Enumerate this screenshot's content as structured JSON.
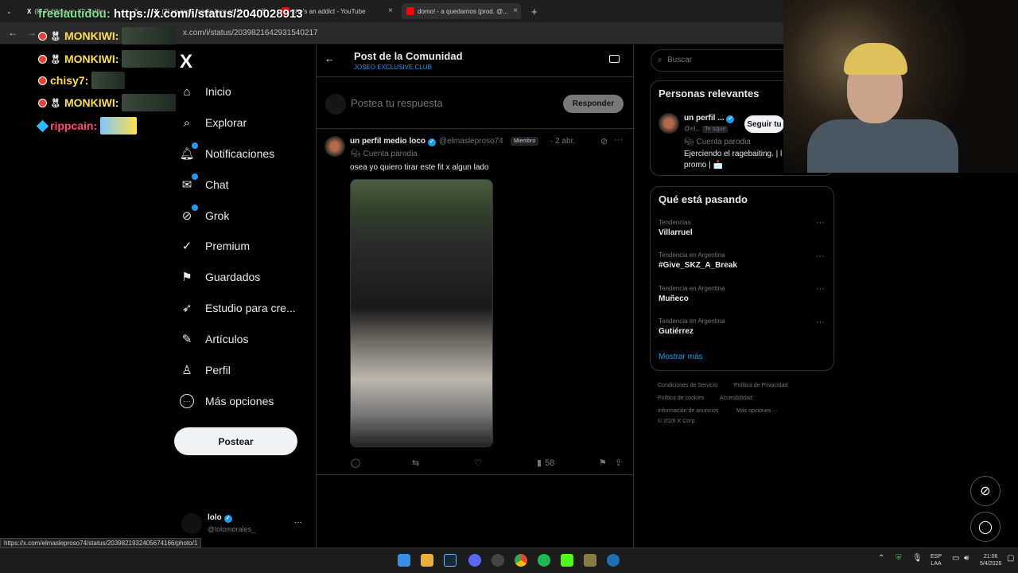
{
  "browser": {
    "tabs": [
      {
        "label": "(8) Publicar en X / Twitter",
        "favicon": "x-favicon"
      },
      {
        "label": "(3) un perfil medio loco en X",
        "favicon": "x-favicon"
      },
      {
        "label": "she's an addict - YouTube",
        "favicon": "youtube-favicon"
      },
      {
        "label": "domo! - a quedarnos (prod. @...",
        "favicon": "youtube-favicon"
      }
    ],
    "new_tab": "+",
    "url": "x.com/i/status/2039821642931540217"
  },
  "overlay": {
    "title_name": "freelautidou:",
    "title_link": " https://x.com/i/status/2040028913",
    "chat": [
      {
        "user": "MONKIWI:",
        "color": "#ffde59"
      },
      {
        "user": "MONKIWI:",
        "color": "#ffde59"
      },
      {
        "user": "chisy7:",
        "color": "#ffde59"
      },
      {
        "user": "MONKIWI:",
        "color": "#ffde59"
      },
      {
        "user": "rippcain:",
        "color": "#ff4d6d"
      }
    ]
  },
  "sidebar": {
    "logo": "X",
    "items": [
      {
        "label": "Inicio",
        "icon": "home-icon",
        "glyph": "⌂"
      },
      {
        "label": "Explorar",
        "icon": "search-icon",
        "glyph": "⌕"
      },
      {
        "label": "Notificaciones",
        "icon": "bell-icon",
        "glyph": "🔔︎",
        "badge": true
      },
      {
        "label": "Chat",
        "icon": "chat-icon",
        "glyph": "✉",
        "badge": true
      },
      {
        "label": "Grok",
        "icon": "grok-icon",
        "glyph": "⊘",
        "badge": true
      },
      {
        "label": "Premium",
        "icon": "premium-icon",
        "glyph": "✓"
      },
      {
        "label": "Guardados",
        "icon": "bookmark-icon",
        "glyph": "⚑"
      },
      {
        "label": "Estudio para cre...",
        "icon": "rocket-icon",
        "glyph": "➶"
      },
      {
        "label": "Artículos",
        "icon": "article-icon",
        "glyph": "✎"
      },
      {
        "label": "Perfil",
        "icon": "person-icon",
        "glyph": "♙"
      },
      {
        "label": "Más opciones",
        "icon": "more-options-icon",
        "glyph": "⋯"
      }
    ],
    "post_button": "Postear",
    "account": {
      "name": "lolo",
      "handle": "@lolomorales_",
      "more": "···"
    }
  },
  "main": {
    "header_title": "Post de la Comunidad",
    "header_subtitle": "JOSEO EXCLUSIVE CLUB",
    "reply_placeholder": "Postea tu respuesta",
    "reply_button": "Responder",
    "tweet": {
      "name": "un perfil medio loco",
      "handle": "@elmasleproso74",
      "member_tag": "Miembro",
      "date": "· 2 abr.",
      "parody": "Cuenta parodia",
      "text": "osea yo quiero tirar este fit x algun lado",
      "views": "58"
    }
  },
  "right": {
    "search_placeholder": "Buscar",
    "relevant_title": "Personas relevantes",
    "relevant_person": {
      "name": "un perfil ...",
      "handle": "@el...",
      "follows_you": "Te sigue",
      "follow_button": "Seguir tu",
      "parody": "Cuenta parodia",
      "bio": "Ejerciendo el ragebaiting. | l",
      "bio2": "promo | 📩"
    },
    "trending_title": "Qué está pasando",
    "trends": [
      {
        "category": "Tendencias",
        "name": "Villarruel"
      },
      {
        "category": "Tendencia en Argentina",
        "name": "#Give_SKZ_A_Break"
      },
      {
        "category": "Tendencia en Argentina",
        "name": "Muñeco"
      },
      {
        "category": "Tendencia en Argentina",
        "name": "Gutiérrez"
      }
    ],
    "show_more": "Mostrar más",
    "footer": [
      "Condiciones de Servicio",
      "Política de Privacidad",
      "Política de cookies",
      "Accesibilidad",
      "Información de anuncios",
      "Más opciones ···",
      "© 2026 X Corp."
    ]
  },
  "status_url": "https://x.com/elmasleproso74/status/2039821932405674166/photo/1",
  "taskbar": {
    "lang": "ESP",
    "lang2": "LAA",
    "time": "21:06",
    "date": "5/4/2026"
  },
  "colors": {
    "accent": "#1d9bf0",
    "verified": "#1d9bf0",
    "background": "#000000"
  }
}
